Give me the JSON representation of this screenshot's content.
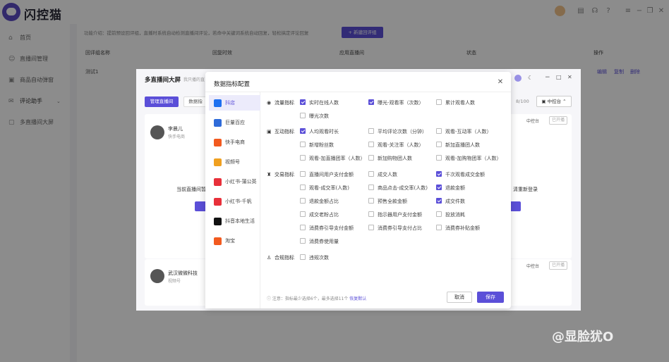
{
  "app": {
    "name": "闪控猫"
  },
  "sidebar": {
    "items": [
      {
        "label": "首页",
        "icon": "home-icon"
      },
      {
        "label": "直播间管理",
        "icon": "user-icon"
      },
      {
        "label": "商品自动弹窗",
        "icon": "bag-icon"
      },
      {
        "label": "评论助手",
        "icon": "comment-icon"
      },
      {
        "label": "多直播间大屏",
        "icon": "screen-icon"
      }
    ]
  },
  "main": {
    "intro": "功能介绍：提前预设回评组，直播时系统自动检测直播间评论，若命中关键词系统自动回复，轻松搞定评论回复",
    "new_button": "新建回评组",
    "table": {
      "headers": [
        "回评组名称",
        "回复时效",
        "应用直播间",
        "状态",
        "操作"
      ],
      "row": {
        "name": "测试1",
        "actions": [
          "编辑",
          "复制",
          "删除"
        ]
      }
    }
  },
  "bigscreen": {
    "title": "多直播间大屏",
    "subtitle": "我只播的直",
    "tab_manage": "管理直播间",
    "tab_data": "数据指",
    "count": "8/100",
    "control": "中控台",
    "cards": [
      {
        "name": "李晨儿",
        "source": "快手电商",
        "label": "中控台",
        "status": "已开播"
      },
      {
        "name": "武汉微微科技",
        "source": "视频号",
        "label": "中控台",
        "status": "已开播"
      }
    ],
    "left_text": "当前直播间暂",
    "right_text": "清重新登录"
  },
  "modal": {
    "title": "数据指标配置",
    "platforms": [
      {
        "label": "抖店",
        "color": "#1e6ff0",
        "selected": true
      },
      {
        "label": "巨量百应",
        "color": "#2f6bd9"
      },
      {
        "label": "快手电商",
        "color": "#f25a1f"
      },
      {
        "label": "视频号",
        "color": "#f0a020"
      },
      {
        "label": "小红书-蒲公英",
        "color": "#e8303a"
      },
      {
        "label": "小红书-千帆",
        "color": "#e8303a"
      },
      {
        "label": "抖音本地生活",
        "color": "#111111"
      },
      {
        "label": "淘宝",
        "color": "#f25a1f"
      }
    ],
    "categories": [
      {
        "label": "流量指标",
        "icon": "traffic-icon",
        "options": [
          {
            "label": "实时在线人数",
            "checked": true
          },
          {
            "label": "曝光-观看率（次数）",
            "checked": true
          },
          {
            "label": "累计观看人数",
            "checked": false
          },
          {
            "label": "曝光次数",
            "checked": false
          }
        ]
      },
      {
        "label": "互动指标",
        "icon": "interaction-icon",
        "options": [
          {
            "label": "人均观看时长",
            "checked": true
          },
          {
            "label": "平均评论次数（分钟）",
            "checked": false
          },
          {
            "label": "观看-互动率（人数）",
            "checked": false
          },
          {
            "label": "新增粉丝数",
            "checked": false
          },
          {
            "label": "观看-关注率（人数）",
            "checked": false
          },
          {
            "label": "新加直播团人数",
            "checked": false
          },
          {
            "label": "观看-加直播团率（人数）",
            "checked": false
          },
          {
            "label": "新加购物团人数",
            "checked": false
          },
          {
            "label": "观看-加购物团率（人数）",
            "checked": false
          }
        ]
      },
      {
        "label": "交易指标",
        "icon": "trade-icon",
        "options": [
          {
            "label": "直播间用户支付金额",
            "checked": false
          },
          {
            "label": "成交人数",
            "checked": false
          },
          {
            "label": "千次观看成交金额",
            "checked": true
          },
          {
            "label": "观看-成交率(人数)",
            "checked": false
          },
          {
            "label": "商品点击-成交率(人数)",
            "checked": false
          },
          {
            "label": "退款金额",
            "checked": true
          },
          {
            "label": "退款金额占比",
            "checked": false
          },
          {
            "label": "预售全款金额",
            "checked": false
          },
          {
            "label": "成交件数",
            "checked": true
          },
          {
            "label": "成交老粉占比",
            "checked": false
          },
          {
            "label": "指示器用户支付金额",
            "checked": false
          },
          {
            "label": "投放消耗",
            "checked": false
          },
          {
            "label": "消费券引导支付金额",
            "checked": false
          },
          {
            "label": "消费券引导支付占比",
            "checked": false
          },
          {
            "label": "消费券补贴金额",
            "checked": false
          },
          {
            "label": "消费券使用量",
            "checked": false
          }
        ]
      },
      {
        "label": "合规指标",
        "icon": "compliance-icon",
        "options": [
          {
            "label": "违规次数",
            "checked": false
          }
        ]
      }
    ],
    "footnote": "注意：指标最少选择6个，最多选择11个",
    "restore": "恢复默认",
    "cancel": "取消",
    "save": "保存"
  },
  "watermark": "@显脸犹O",
  "colors": {
    "accent": "#5b4fd8"
  }
}
